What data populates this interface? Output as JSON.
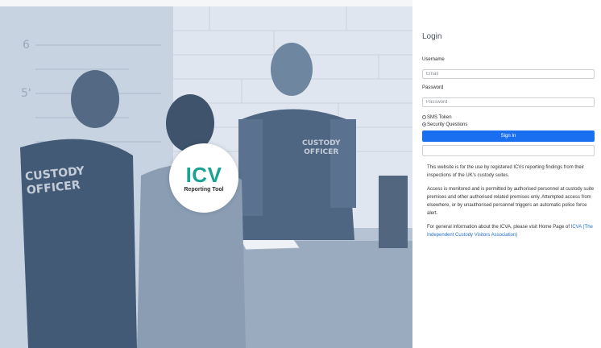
{
  "hero": {
    "logo_mark": "ICV",
    "logo_subtitle": "Reporting Tool",
    "officer_badge_left": [
      "CUSTODY",
      "OFFICER"
    ],
    "officer_badge_right": [
      "CUSTODY",
      "OFFICER"
    ],
    "height_marks": [
      "6",
      "5'"
    ]
  },
  "login": {
    "title": "Login",
    "username_label": "Username",
    "username_placeholder": "Email",
    "password_label": "Password",
    "password_placeholder": "Password",
    "options": [
      {
        "label": "SMS Token",
        "checked": false
      },
      {
        "label": "Security Questions",
        "checked": true
      }
    ],
    "signin_label": "Sign In"
  },
  "info": {
    "p1": "This website is for the use by registered ICVs reporting findings from their inspections of the UK's custody suites.",
    "p2": "Access is monitored and is permitted by authorised personnel at custody suite premises and other authorised related premises only. Attempted access from elsewhere, or by unauthorised personnel triggers an automatic police force alert.",
    "p3_prefix": "For general information about the ICVA, please visit Home Page of",
    "p3_link": "ICVA (The Independent Custody Visitors Association)"
  }
}
